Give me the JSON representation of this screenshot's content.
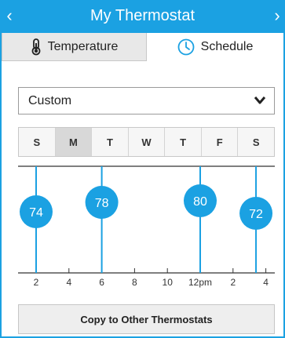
{
  "header": {
    "title": "My Thermostat",
    "prev_glyph": "‹",
    "next_glyph": "›",
    "prev_icon": "chevron-left-icon",
    "next_icon": "chevron-right-icon",
    "accent_color": "#1ba1e2"
  },
  "tabs": [
    {
      "label": "Temperature",
      "icon": "thermometer-icon",
      "active": false
    },
    {
      "label": "Schedule",
      "icon": "clock-icon",
      "active": true
    }
  ],
  "schedule_select": {
    "value": "Custom",
    "icon": "chevron-down-icon"
  },
  "days": [
    {
      "label": "S",
      "selected": false
    },
    {
      "label": "M",
      "selected": true
    },
    {
      "label": "T",
      "selected": false
    },
    {
      "label": "W",
      "selected": false
    },
    {
      "label": "T",
      "selected": false
    },
    {
      "label": "F",
      "selected": false
    },
    {
      "label": "S",
      "selected": false
    }
  ],
  "timeline": {
    "ticks": [
      {
        "hour": 2,
        "label": "2"
      },
      {
        "hour": 4,
        "label": "4"
      },
      {
        "hour": 6,
        "label": "6"
      },
      {
        "hour": 8,
        "label": "8"
      },
      {
        "hour": 10,
        "label": "10"
      },
      {
        "hour": 12,
        "label": "12pm"
      },
      {
        "hour": 14,
        "label": "2"
      },
      {
        "hour": 16,
        "label": "4"
      }
    ],
    "setpoints": [
      {
        "hour": 2,
        "temp": "74"
      },
      {
        "hour": 6,
        "temp": "78"
      },
      {
        "hour": 12,
        "temp": "80"
      },
      {
        "hour": 15.4,
        "temp": "72"
      }
    ],
    "marker_color": "#1ba1e2"
  },
  "copy_button": {
    "label": "Copy to Other Thermostats"
  }
}
